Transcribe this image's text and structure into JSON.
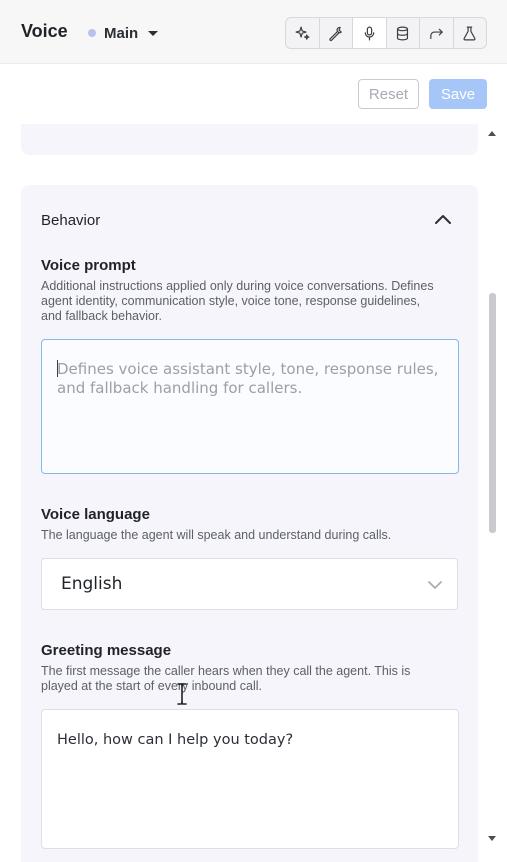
{
  "header": {
    "title": "Voice",
    "branch": {
      "label": "Main",
      "dot_color": "#b9c2ef"
    },
    "toolbar": [
      {
        "icon": "sparkles-icon",
        "active": false
      },
      {
        "icon": "wrench-icon",
        "active": false
      },
      {
        "icon": "microphone-icon",
        "active": true
      },
      {
        "icon": "database-icon",
        "active": false
      },
      {
        "icon": "forward-arrow-icon",
        "active": false
      },
      {
        "icon": "flask-icon",
        "active": false
      }
    ]
  },
  "actions": {
    "reset_label": "Reset",
    "save_label": "Save"
  },
  "behavior": {
    "title": "Behavior",
    "voice_prompt": {
      "label": "Voice prompt",
      "description": "Additional instructions applied only during voice conversations. Defines agent identity, communication style, voice tone, response guidelines, and fallback behavior.",
      "placeholder": "Defines voice assistant style, tone, response rules, and fallback handling for callers.",
      "value": ""
    },
    "voice_language": {
      "label": "Voice language",
      "description": "The language the agent will speak and understand during calls.",
      "value": "English"
    },
    "greeting_message": {
      "label": "Greeting message",
      "description": "The first message the caller hears when they call the agent. This is played at the start of every inbound call.",
      "value": "Hello, how can I help you today?"
    }
  },
  "colors": {
    "accent": "#a6c6f7",
    "focus_border": "#86b9e6",
    "card_background": "#f6f5fb"
  }
}
